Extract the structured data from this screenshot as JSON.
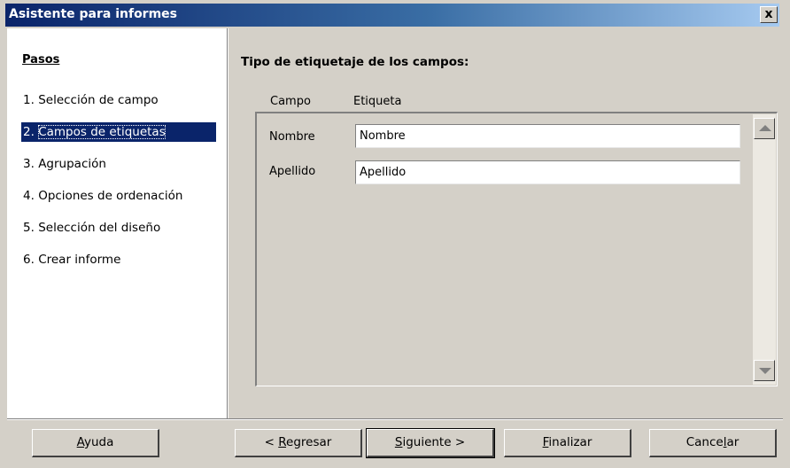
{
  "window": {
    "title": "Asistente para informes",
    "close_label": "x"
  },
  "sidebar": {
    "title": "Pasos",
    "steps": [
      {
        "number": "1.",
        "label": "Selección de campo"
      },
      {
        "number": "2.",
        "label": "Campos de etiquetas",
        "active": true
      },
      {
        "number": "3.",
        "label": "Agrupación"
      },
      {
        "number": "4.",
        "label": "Opciones de ordenación"
      },
      {
        "number": "5.",
        "label": "Selección del diseño"
      },
      {
        "number": "6.",
        "label": "Crear informe"
      }
    ]
  },
  "main": {
    "title": "Tipo de etiquetaje de los campos:",
    "columns": {
      "field": "Campo",
      "label": "Etiqueta"
    },
    "fields": [
      {
        "name": "Nombre",
        "value": "Nombre"
      },
      {
        "name": "Apellido",
        "value": "Apellido"
      }
    ]
  },
  "buttons": {
    "help": {
      "pre": "",
      "key": "A",
      "post": "yuda"
    },
    "back": {
      "pre": "< ",
      "key": "R",
      "post": "egresar"
    },
    "next": {
      "pre": "",
      "key": "S",
      "post": "iguiente >"
    },
    "finish": {
      "pre": "",
      "key": "F",
      "post": "inalizar"
    },
    "cancel": {
      "pre": "Cance",
      "key": "l",
      "post": "ar"
    }
  },
  "colors": {
    "selection": "#0a246a",
    "dialog_bg": "#d4d0c8"
  }
}
